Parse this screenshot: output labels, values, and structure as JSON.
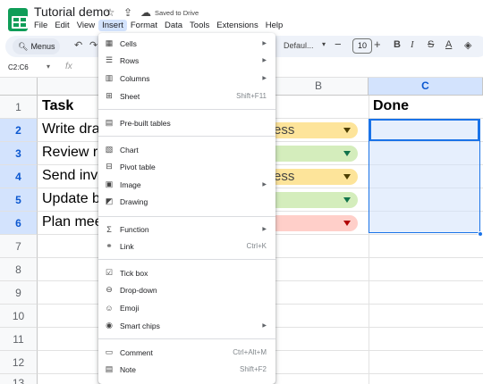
{
  "app": {
    "title": "Tutorial demo",
    "saved_status": "Saved to Drive"
  },
  "menubar": [
    "File",
    "Edit",
    "View",
    "Insert",
    "Format",
    "Data",
    "Tools",
    "Extensions",
    "Help"
  ],
  "toolbar": {
    "menus_label": "Menus",
    "font": "Defaul...",
    "font_size": "10"
  },
  "formula_bar": {
    "name_box": "C2:C6",
    "fx_label": "fx"
  },
  "grid": {
    "columns": [
      "B",
      "C"
    ],
    "rows": [
      "1",
      "2",
      "3",
      "4",
      "5",
      "6",
      "7",
      "8",
      "9",
      "10",
      "11",
      "12",
      "13"
    ],
    "header_task": "Task",
    "header_done": "Done",
    "tasks": [
      "Write dra",
      "Review r",
      "Send inv",
      "Update b",
      "Plan mee"
    ],
    "statuses": [
      "ess",
      "",
      "ess",
      "",
      ""
    ]
  },
  "insert_menu": {
    "items": [
      {
        "label": "Cells",
        "icon": "cells-icon",
        "submenu": true
      },
      {
        "label": "Rows",
        "icon": "rows-icon",
        "submenu": true
      },
      {
        "label": "Columns",
        "icon": "columns-icon",
        "submenu": true
      },
      {
        "label": "Sheet",
        "icon": "sheet-icon",
        "shortcut": "Shift+F11"
      },
      {
        "label": "Pre-built tables",
        "icon": "prebuilt-tables-icon"
      },
      {
        "label": "Chart",
        "icon": "chart-icon"
      },
      {
        "label": "Pivot table",
        "icon": "pivot-table-icon"
      },
      {
        "label": "Image",
        "icon": "image-icon",
        "submenu": true
      },
      {
        "label": "Drawing",
        "icon": "drawing-icon"
      },
      {
        "label": "Function",
        "icon": "sigma-icon",
        "submenu": true
      },
      {
        "label": "Link",
        "icon": "link-icon",
        "shortcut": "Ctrl+K"
      },
      {
        "label": "Tick box",
        "icon": "checkbox-icon"
      },
      {
        "label": "Drop-down",
        "icon": "dropdown-icon"
      },
      {
        "label": "Emoji",
        "icon": "emoji-icon"
      },
      {
        "label": "Smart chips",
        "icon": "smart-chips-icon",
        "submenu": true
      },
      {
        "label": "Comment",
        "icon": "comment-icon",
        "shortcut": "Ctrl+Alt+M"
      },
      {
        "label": "Note",
        "icon": "note-icon",
        "shortcut": "Shift+F2"
      }
    ]
  },
  "colors": {
    "accent": "#1a73e8",
    "sheets_green": "#0f9d58",
    "selection": "#d3e3fd"
  }
}
